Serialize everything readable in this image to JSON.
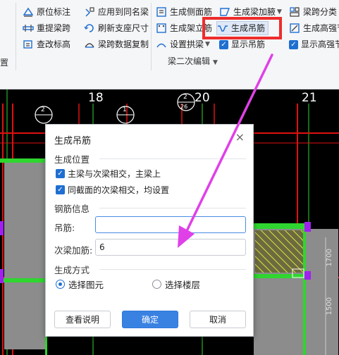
{
  "ribbon": {
    "col1": [
      "原位标注",
      "重提梁跨",
      "查改标高"
    ],
    "col2": [
      "应用到同名梁",
      "刷新支座尺寸",
      "梁跨数据复制"
    ],
    "col3": [
      "生成侧面筋",
      "生成架立筋",
      "设置拱梁"
    ],
    "col4": [
      "生成梁加腋",
      "生成吊筋",
      "显示吊筋"
    ],
    "col5": [
      "梁跨分类",
      "生成高强节",
      "显示高强节"
    ],
    "group_caption": "梁二次编辑",
    "left_stub": "置"
  },
  "canvas": {
    "axis_labels": [
      "18",
      "20",
      "21"
    ],
    "bubble_labels": [
      "2",
      "1",
      "2"
    ],
    "bubble_circle": "26",
    "dimension_text": "1700",
    "dimension_text2": "1500"
  },
  "dialog": {
    "title": "生成吊筋",
    "close": "×",
    "section_position": "生成位置",
    "check1": "主梁与次梁相交，主梁上",
    "check2": "同截面的次梁相交，均设置",
    "section_rebar": "钢筋信息",
    "hanger_label": "吊筋:",
    "hanger_value": "",
    "secondary_label": "次梁加筋:",
    "secondary_value": "6",
    "section_mode": "生成方式",
    "radio_pick": "选择图元",
    "radio_floor": "选择楼层",
    "btn_help": "查看说明",
    "btn_ok": "确定",
    "btn_cancel": "取消"
  },
  "colors": {
    "highlight_red": "#ee2c2c",
    "pointer_magenta": "#e040e8",
    "accent_blue": "#1f6fd1",
    "wall_green": "#2fd62f",
    "beam_red": "#e01010",
    "slab_gray": "#8c8c8c"
  }
}
